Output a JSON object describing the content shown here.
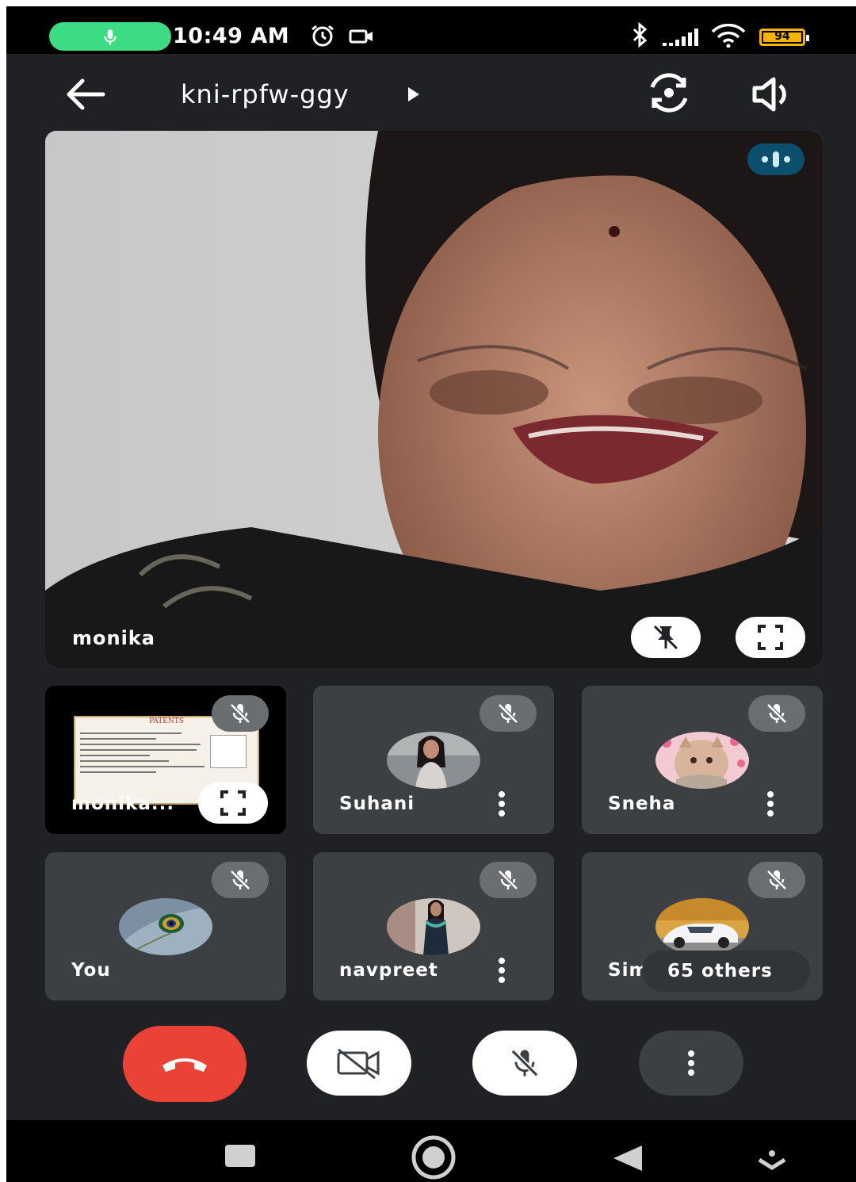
{
  "status_bar": {
    "time": "10:49 AM",
    "battery": "94"
  },
  "appbar": {
    "meeting_code": "kni-rpfw-ggy"
  },
  "main_video": {
    "participant_name": "monika"
  },
  "tiles": [
    {
      "name": "monika...",
      "type": "presentation",
      "slide_title": "PATENTS"
    },
    {
      "name": "Suhani",
      "type": "avatar"
    },
    {
      "name": "Sneha",
      "type": "avatar"
    },
    {
      "name": "You",
      "type": "avatar"
    },
    {
      "name": "navpreet",
      "type": "avatar"
    },
    {
      "name": "Simran",
      "type": "avatar",
      "others_label": "65 others"
    }
  ],
  "colors": {
    "background": "#202124",
    "tile": "#3c4043",
    "end_call": "#ea4335",
    "mic_active": "#3ddc84",
    "speaking_badge": "#0b4f6c"
  },
  "icons": [
    "back-arrow-icon",
    "play-arrow-icon",
    "switch-camera-icon",
    "speaker-icon",
    "unpin-icon",
    "fullscreen-icon",
    "mic-off-icon",
    "more-vert-icon",
    "end-call-icon",
    "camera-off-icon",
    "recents-icon",
    "home-icon",
    "back-nav-icon",
    "keyboard-hide-icon"
  ]
}
